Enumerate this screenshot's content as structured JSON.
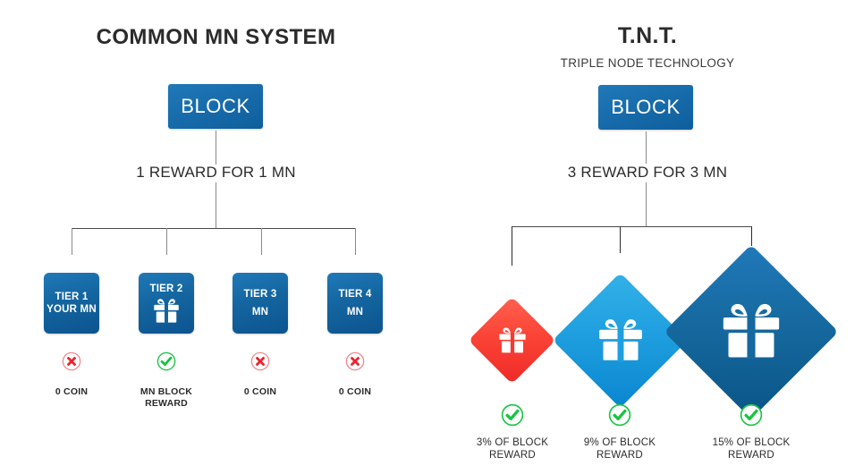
{
  "left": {
    "title": "COMMON MN SYSTEM",
    "block_label": "BLOCK",
    "reward_text": "1 REWARD FOR 1 MN",
    "tiers": [
      {
        "label": "TIER 1",
        "sub": "YOUR\nMN",
        "icon": "",
        "status": "cross-icon",
        "caption": "0 COIN"
      },
      {
        "label": "TIER 2",
        "sub": "",
        "icon": "gift-icon",
        "status": "check-icon",
        "caption": "MN BLOCK\nREWARD"
      },
      {
        "label": "TIER 3",
        "sub": "MN",
        "icon": "",
        "status": "cross-icon",
        "caption": "0 COIN"
      },
      {
        "label": "TIER 4",
        "sub": "MN",
        "icon": "",
        "status": "cross-icon",
        "caption": "0 COIN"
      }
    ]
  },
  "right": {
    "title": "T.N.T.",
    "subtitle": "TRIPLE NODE TECHNOLOGY",
    "block_label": "BLOCK",
    "reward_text": "3 REWARD FOR 3 MN",
    "nodes": [
      {
        "icon": "gift-icon",
        "color": "#f53a30",
        "status": "check-icon",
        "caption": "3% OF BLOCK\nREWARD"
      },
      {
        "icon": "gift-icon",
        "color": "#1f9fdf",
        "status": "check-icon",
        "caption": "9% OF BLOCK\nREWARD"
      },
      {
        "icon": "gift-icon",
        "color": "#1166a0",
        "status": "check-icon",
        "caption": "15% OF BLOCK\nREWARD"
      }
    ]
  },
  "colors": {
    "block_blue": "#1a6fae",
    "tier_blue": "#14659f",
    "check_green": "#18c441",
    "cross_red": "#e8242e",
    "cross_ring": "#f4868a",
    "node_red": "#f53a30",
    "node_light_blue": "#1f9fdf",
    "node_dark_blue": "#1166a0",
    "connector": "#4a4a4a",
    "text": "#2b2b2b"
  }
}
